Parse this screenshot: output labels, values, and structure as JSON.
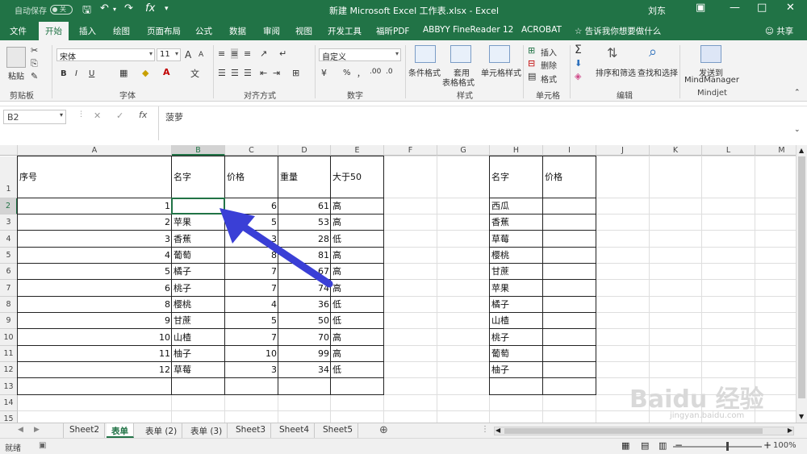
{
  "titlebar": {
    "autosave_label": "自动保存",
    "autosave_state": "关",
    "title": "新建 Microsoft Excel 工作表.xlsx  -  Excel",
    "user": "刘东",
    "fx_icon": "fx-icon"
  },
  "tabs": [
    "文件",
    "开始",
    "插入",
    "绘图",
    "页面布局",
    "公式",
    "数据",
    "审阅",
    "视图",
    "开发工具",
    "福昕PDF",
    "ABBYY FineReader 12",
    "ACROBAT"
  ],
  "tell_me": "告诉我你想要做什么",
  "share": "共享",
  "ribbon": {
    "clipboard": {
      "paste": "粘贴",
      "group": "剪贴板"
    },
    "font": {
      "name": "宋体",
      "size": "11",
      "bold": "B",
      "italic": "I",
      "underline": "U",
      "grow": "A",
      "shrink": "A",
      "group": "字体"
    },
    "align": {
      "group": "对齐方式"
    },
    "number": {
      "format": "自定义",
      "percent": "%",
      "comma": "，",
      "group": "数字"
    },
    "styles": {
      "cond": "条件格式",
      "table1": "套用",
      "table2": "表格格式",
      "cell": "单元格样式",
      "group": "样式"
    },
    "cells": {
      "insert": "插入",
      "delete": "删除",
      "format": "格式",
      "group": "单元格"
    },
    "editing": {
      "sort": "排序和筛选",
      "find": "查找和选择",
      "group": "编辑"
    },
    "mindjet": {
      "send1": "发送到",
      "send2": "MindManager",
      "group": "Mindjet"
    }
  },
  "formula": {
    "namebox": "B2",
    "content": "菠萝"
  },
  "columns": [
    "A",
    "B",
    "C",
    "D",
    "E",
    "F",
    "G",
    "H",
    "I",
    "J",
    "K",
    "L",
    "M"
  ],
  "rows": [
    "1",
    "2",
    "3",
    "4",
    "5",
    "6",
    "7",
    "8",
    "9",
    "10",
    "11",
    "12",
    "13",
    "14",
    "15"
  ],
  "headers": {
    "a1": "序号",
    "b1": "名字",
    "c1": "价格",
    "d1": "重量",
    "e1": "大于50",
    "h1": "名字",
    "i1": "价格"
  },
  "table": [
    {
      "n": "1",
      "name": "",
      "price": "6",
      "weight": "61",
      "flag": "高"
    },
    {
      "n": "2",
      "name": "苹果",
      "price": "5",
      "weight": "53",
      "flag": "高"
    },
    {
      "n": "3",
      "name": "香蕉",
      "price": "3",
      "weight": "28",
      "flag": "低"
    },
    {
      "n": "4",
      "name": "葡萄",
      "price": "8",
      "weight": "81",
      "flag": "高"
    },
    {
      "n": "5",
      "name": "橘子",
      "price": "7",
      "weight": "67",
      "flag": "高"
    },
    {
      "n": "6",
      "name": "桃子",
      "price": "7",
      "weight": "74",
      "flag": "高"
    },
    {
      "n": "8",
      "name": "樱桃",
      "price": "4",
      "weight": "36",
      "flag": "低"
    },
    {
      "n": "9",
      "name": "甘蔗",
      "price": "5",
      "weight": "50",
      "flag": "低"
    },
    {
      "n": "10",
      "name": "山楂",
      "price": "7",
      "weight": "70",
      "flag": "高"
    },
    {
      "n": "11",
      "name": "柚子",
      "price": "10",
      "weight": "99",
      "flag": "高"
    },
    {
      "n": "12",
      "name": "草莓",
      "price": "3",
      "weight": "34",
      "flag": "低"
    }
  ],
  "lookup": [
    "西瓜",
    "香蕉",
    "草莓",
    "樱桃",
    "甘蔗",
    "苹果",
    "橘子",
    "山楂",
    "桃子",
    "葡萄",
    "柚子"
  ],
  "sheets": [
    "Sheet2",
    "表单",
    "表单 (2)",
    "表单 (3)",
    "Sheet3",
    "Sheet4",
    "Sheet5"
  ],
  "active_sheet": "表单",
  "status": {
    "ready": "就绪",
    "zoom": "100%"
  },
  "watermark": {
    "text": "Baidu 经验",
    "url": "jingyan.baidu.com"
  },
  "colors": {
    "excel_green": "#217346",
    "arrow_blue": "#3a3fd6"
  }
}
